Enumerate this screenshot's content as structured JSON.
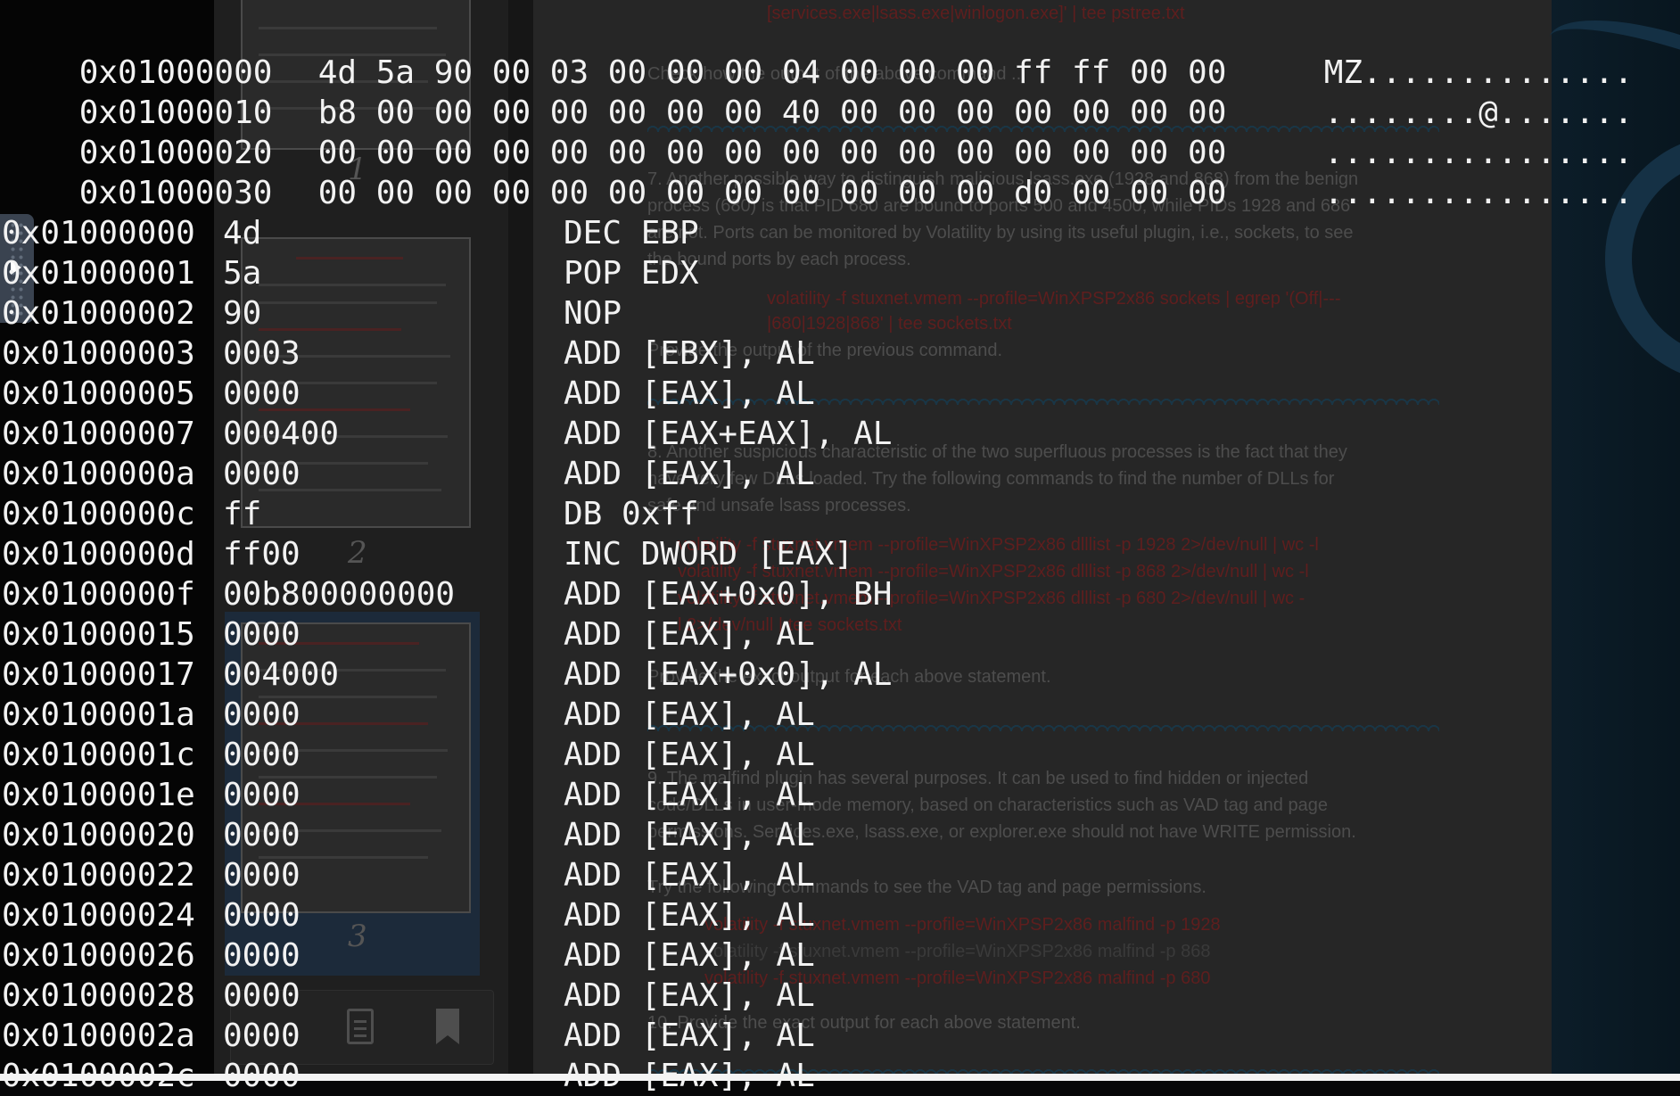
{
  "hexdump": [
    {
      "addr": "0x01000000",
      "bytes": "4d 5a 90 00 03 00 00 00 04 00 00 00 ff ff 00 00",
      "ascii": "MZ.............."
    },
    {
      "addr": "0x01000010",
      "bytes": "b8 00 00 00 00 00 00 00 40 00 00 00 00 00 00 00",
      "ascii": "........@......."
    },
    {
      "addr": "0x01000020",
      "bytes": "00 00 00 00 00 00 00 00 00 00 00 00 00 00 00 00",
      "ascii": "................"
    },
    {
      "addr": "0x01000030",
      "bytes": "00 00 00 00 00 00 00 00 00 00 00 00 d0 00 00 00",
      "ascii": "................"
    }
  ],
  "disassembly": [
    {
      "addr": "0x01000000",
      "op": "4d",
      "ins": "DEC EBP"
    },
    {
      "addr": "0x01000001",
      "op": "5a",
      "ins": "POP EDX"
    },
    {
      "addr": "0x01000002",
      "op": "90",
      "ins": "NOP"
    },
    {
      "addr": "0x01000003",
      "op": "0003",
      "ins": "ADD [EBX], AL"
    },
    {
      "addr": "0x01000005",
      "op": "0000",
      "ins": "ADD [EAX], AL"
    },
    {
      "addr": "0x01000007",
      "op": "000400",
      "ins": "ADD [EAX+EAX], AL"
    },
    {
      "addr": "0x0100000a",
      "op": "0000",
      "ins": "ADD [EAX], AL"
    },
    {
      "addr": "0x0100000c",
      "op": "ff",
      "ins": "DB 0xff"
    },
    {
      "addr": "0x0100000d",
      "op": "ff00",
      "ins": "INC DWORD [EAX]"
    },
    {
      "addr": "0x0100000f",
      "op": "00b800000000",
      "ins": "ADD [EAX+0x0], BH"
    },
    {
      "addr": "0x01000015",
      "op": "0000",
      "ins": "ADD [EAX], AL"
    },
    {
      "addr": "0x01000017",
      "op": "004000",
      "ins": "ADD [EAX+0x0], AL"
    },
    {
      "addr": "0x0100001a",
      "op": "0000",
      "ins": "ADD [EAX], AL"
    },
    {
      "addr": "0x0100001c",
      "op": "0000",
      "ins": "ADD [EAX], AL"
    },
    {
      "addr": "0x0100001e",
      "op": "0000",
      "ins": "ADD [EAX], AL"
    },
    {
      "addr": "0x01000020",
      "op": "0000",
      "ins": "ADD [EAX], AL"
    },
    {
      "addr": "0x01000022",
      "op": "0000",
      "ins": "ADD [EAX], AL"
    },
    {
      "addr": "0x01000024",
      "op": "0000",
      "ins": "ADD [EAX], AL"
    },
    {
      "addr": "0x01000026",
      "op": "0000",
      "ins": "ADD [EAX], AL"
    },
    {
      "addr": "0x01000028",
      "op": "0000",
      "ins": "ADD [EAX], AL"
    },
    {
      "addr": "0x0100002a",
      "op": "0000",
      "ins": "ADD [EAX], AL"
    },
    {
      "addr": "0x0100002c",
      "op": "0000",
      "ins": "ADD [EAX], AL"
    }
  ],
  "background_document": {
    "thumbnail_page_numbers": [
      "1",
      "2",
      "3"
    ],
    "lines": [
      {
        "text": "[services.exe|lsass.exe|winlogon.exe]' | tee pstree.txt",
        "red": true
      },
      {
        "text": "Check how the output of the above command ...",
        "red": false
      },
      {
        "text": "7. Another possible way to distinguish malicious lsass.exe (1928 and 868) from the benign",
        "red": false
      },
      {
        "text": "process (680) is that PID 680 are bound to ports 500 and 4500, while PIDs 1928 and 686",
        "red": false
      },
      {
        "text": "are not. Ports can be monitored by Volatility by using its useful plugin, i.e., sockets, to see",
        "red": false
      },
      {
        "text": "the bound ports by each process.",
        "red": false
      },
      {
        "text": "volatility -f stuxnet.vmem --profile=WinXPSP2x86 sockets | egrep '(Off|---",
        "red": true
      },
      {
        "text": "|680|1928|868' | tee sockets.txt",
        "red": true
      },
      {
        "text": "Provide the output of the previous command.",
        "red": false
      },
      {
        "text": "8. Another suspicious characteristic of the two superfluous processes is the fact that they",
        "red": false
      },
      {
        "text": "have very few DLLs loaded. Try the following commands to find the number of DLLs for",
        "red": false
      },
      {
        "text": "safe and unsafe lsass processes.",
        "red": false
      },
      {
        "text": "volatility -f stuxnet.vmem --profile=WinXPSP2x86 dlllist -p 1928 2>/dev/null | wc -l",
        "red": true
      },
      {
        "text": "volatility -f stuxnet.vmem --profile=WinXPSP2x86 dlllist -p 868 2>/dev/null | wc -l",
        "red": true
      },
      {
        "text": "volatility -f stuxnet.vmem --profile=WinXPSP2x86 dlllist -p 680 2>/dev/null | wc -",
        "red": true
      },
      {
        "text": "l 2>/dev/null | tee sockets.txt",
        "red": true
      },
      {
        "text": "Provide the exact output for each above statement.",
        "red": false
      },
      {
        "text": "9. The malfind plugin has several purposes. It can be used to find hidden or injected",
        "red": false
      },
      {
        "text": "code/DLLs in user-mode memory, based on characteristics such as VAD tag and page",
        "red": false
      },
      {
        "text": "permissions. Services.exe, lsass.exe, or explorer.exe should not have WRITE permission.",
        "red": false
      },
      {
        "text": "Try the following commands to see the VAD tag and page permissions.",
        "red": false
      },
      {
        "text": "volatility -f stuxnet.vmem --profile=WinXPSP2x86 malfind -p 1928",
        "red": true
      },
      {
        "text": "volatility -f stuxnet.vmem --profile=WinXPSP2x86 malfind -p 868",
        "red": false
      },
      {
        "text": "volatility -f stuxnet.vmem --profile=WinXPSP2x86 malfind -p 680",
        "red": true
      },
      {
        "text": "10. Provide the exact output for each above statement.",
        "red": false
      }
    ]
  },
  "icons": {
    "side_tab": "play-icon",
    "toolbar": [
      "document-icon",
      "bookmark-icon"
    ]
  }
}
